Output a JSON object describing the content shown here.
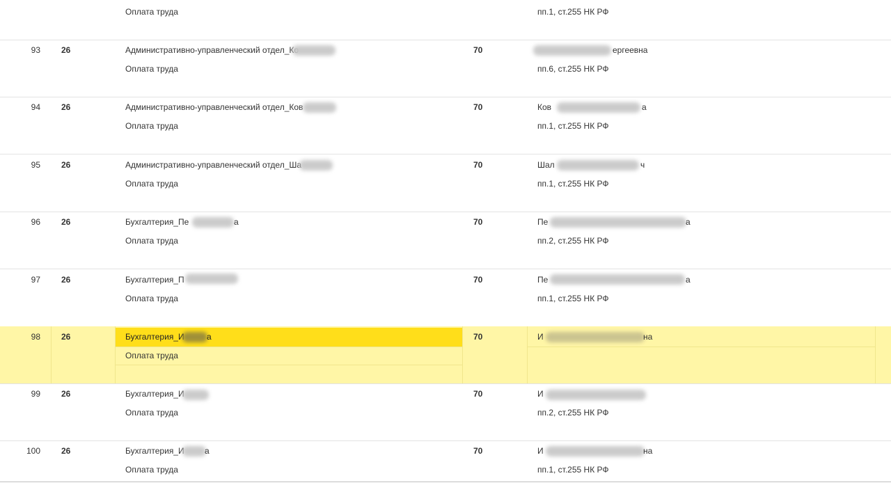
{
  "partial_row": {
    "sub2": "Оплата труда",
    "credit_sub2": "пп.1, ст.255 НК РФ"
  },
  "rows": [
    {
      "num": "93",
      "debit": "26",
      "sub1": "Административно-управленческий отдел_Ко",
      "sub2": "Оплата труда",
      "credit": "70",
      "credit_sub1": "ергеевна",
      "credit_sub2": "пп.6, ст.255 НК РФ"
    },
    {
      "num": "94",
      "debit": "26",
      "sub1": "Административно-управленческий отдел_Ков",
      "sub2": "Оплата труда",
      "credit": "70",
      "credit_sub1": "Ков",
      "credit_sub1_end": "а",
      "credit_sub2": "пп.1, ст.255 НК РФ"
    },
    {
      "num": "95",
      "debit": "26",
      "sub1": "Административно-управленческий отдел_Ша",
      "sub2": "Оплата труда",
      "credit": "70",
      "credit_sub1": "Шал",
      "credit_sub1_end": "ч",
      "credit_sub2": "пп.1, ст.255 НК РФ"
    },
    {
      "num": "96",
      "debit": "26",
      "sub1": "Бухгалтерия_Пе",
      "sub1_end": "а",
      "sub2": "Оплата труда",
      "credit": "70",
      "credit_sub1": "Пе",
      "credit_sub1_end": "а",
      "credit_sub2": "пп.2, ст.255 НК РФ"
    },
    {
      "num": "97",
      "debit": "26",
      "sub1": "Бухгалтерия_П",
      "sub2": "Оплата труда",
      "credit": "70",
      "credit_sub1": "Пе",
      "credit_sub1_end": "а",
      "credit_sub2": "пп.1, ст.255 НК РФ"
    },
    {
      "num": "98",
      "debit": "26",
      "sub1": "Бухгалтерия_И",
      "sub1_end": "а",
      "sub2": "Оплата труда",
      "credit": "70",
      "credit_sub1": "И",
      "credit_sub1_end": "на",
      "credit_sub2": ""
    },
    {
      "num": "99",
      "debit": "26",
      "sub1": "Бухгалтерия_И",
      "sub2": "Оплата труда",
      "credit": "70",
      "credit_sub1": "И",
      "credit_sub2": "пп.2, ст.255 НК РФ"
    },
    {
      "num": "100",
      "debit": "26",
      "sub1": "Бухгалтерия_И",
      "sub1_end": "а",
      "sub2": "Оплата труда",
      "credit": "70",
      "credit_sub1": "И",
      "credit_sub1_end": "на",
      "credit_sub2": "пп.1, ст.255 НК РФ"
    }
  ],
  "colors": {
    "selected_row": "#fff6a6",
    "selected_cell": "#ffde1a",
    "row_border": "#e3e3e3"
  }
}
